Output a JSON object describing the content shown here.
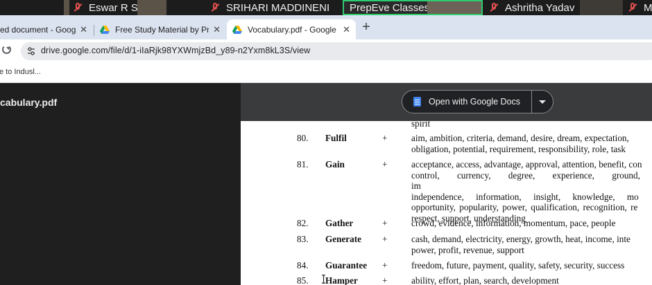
{
  "meeting": {
    "participants": [
      {
        "name": "Eswar R S",
        "muted": true
      },
      {
        "name": "SRIHARI MADDINENI",
        "muted": true
      },
      {
        "name": "PrepEve Classes",
        "muted": false,
        "active": true
      },
      {
        "name": "Ashritha Yadav",
        "muted": true
      },
      {
        "name": "M",
        "muted": true
      }
    ]
  },
  "browser": {
    "tabs": [
      {
        "title": "ed document - Google D",
        "icon": "docs-icon"
      },
      {
        "title": "Free Study Material by PrepE",
        "icon": "drive-icon"
      },
      {
        "title": "Vocabulary.pdf - Google Driv",
        "icon": "drive-icon",
        "active": true
      }
    ],
    "new_tab_label": "+",
    "url": "drive.google.com/file/d/1-iIaRjk98YXWmjzBd_y89-n2Yxm8kL3S/view",
    "bookmark": "e to Indusl..."
  },
  "viewer": {
    "file_name": "cabulary.pdf",
    "open_with_label": "Open with Google Docs"
  },
  "document": {
    "prev_tail": "spirit",
    "entries": [
      {
        "num": "80.",
        "word": "Fulfil",
        "sign": "+",
        "lines": [
          "aim, ambition, criteria, demand, desire, dream, expectation,",
          "obligation, potential, requirement, responsibility, role, task"
        ]
      },
      {
        "num": "81.",
        "word": "Gain",
        "sign": "+",
        "lines": [
          "acceptance, access, advantage, approval, attention, benefit, con",
          "control, currency, degree, experience, ground, im",
          "independence, information, insight, knowledge, mo",
          "opportunity, popularity, power, qualification, recognition, re",
          "respect, support, understanding"
        ]
      },
      {
        "num": "82.",
        "word": "Gather",
        "sign": "+",
        "lines": [
          "crowd, evidence, information, momentum, pace, people"
        ]
      },
      {
        "num": "83.",
        "word": "Generate",
        "sign": "+",
        "lines": [
          "cash, demand, electricity, energy, growth, heat, income, inte",
          "power, profit, revenue, support"
        ]
      },
      {
        "num": "84.",
        "word": "Guarantee",
        "sign": "+",
        "lines": [
          "freedom, future, payment, quality, safety, security, success"
        ]
      },
      {
        "num": "85.",
        "word": "Hamper",
        "sign": "+",
        "lines": [
          "ability, effort, plan, search, development"
        ]
      }
    ]
  }
}
